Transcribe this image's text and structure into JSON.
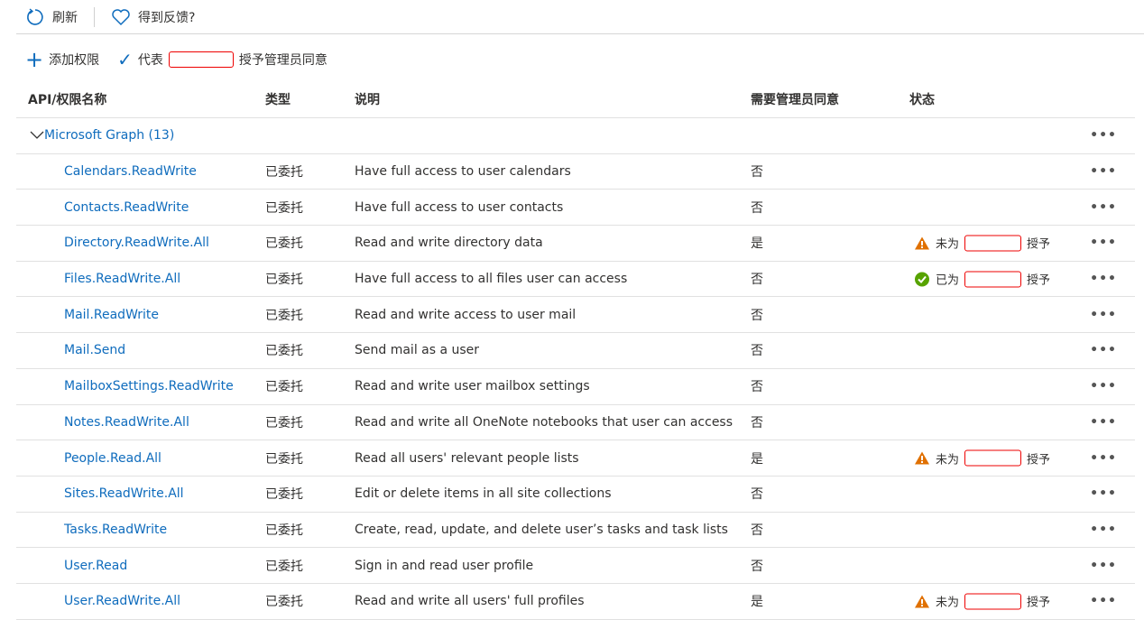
{
  "toolbar": {
    "refresh": "刷新",
    "feedback": "得到反馈?"
  },
  "commands": {
    "add": "添加权限",
    "grant_prefix": "代表",
    "grant_suffix": "授予管理员同意"
  },
  "columns": [
    "API/权限名称",
    "类型",
    "说明",
    "需要管理员同意",
    "状态"
  ],
  "group": {
    "label": "Microsoft Graph (13)"
  },
  "colors": {
    "link": "#0f6cbd",
    "warning": "#e07000",
    "success": "#57a300",
    "redact": "#e00000"
  },
  "rows": [
    {
      "name": "Calendars.ReadWrite",
      "type": "已委托",
      "desc": "Have full access to user calendars",
      "admin": "否",
      "status": "",
      "status_suffix": "",
      "status_icon": ""
    },
    {
      "name": "Contacts.ReadWrite",
      "type": "已委托",
      "desc": "Have full access to user contacts",
      "admin": "否",
      "status": "",
      "status_suffix": "",
      "status_icon": ""
    },
    {
      "name": "Directory.ReadWrite.All",
      "type": "已委托",
      "desc": "Read and write directory data",
      "admin": "是",
      "status": "未为",
      "status_suffix": "授予",
      "status_icon": "warning-icon"
    },
    {
      "name": "Files.ReadWrite.All",
      "type": "已委托",
      "desc": "Have full access to all files user can access",
      "admin": "否",
      "status": "已为",
      "status_suffix": "授予",
      "status_icon": "check-circle-icon"
    },
    {
      "name": "Mail.ReadWrite",
      "type": "已委托",
      "desc": "Read and write access to user mail",
      "admin": "否",
      "status": "",
      "status_suffix": "",
      "status_icon": ""
    },
    {
      "name": "Mail.Send",
      "type": "已委托",
      "desc": "Send mail as a user",
      "admin": "否",
      "status": "",
      "status_suffix": "",
      "status_icon": ""
    },
    {
      "name": "MailboxSettings.ReadWrite",
      "type": "已委托",
      "desc": "Read and write user mailbox settings",
      "admin": "否",
      "status": "",
      "status_suffix": "",
      "status_icon": ""
    },
    {
      "name": "Notes.ReadWrite.All",
      "type": "已委托",
      "desc": "Read and write all OneNote notebooks that user can access",
      "admin": "否",
      "status": "",
      "status_suffix": "",
      "status_icon": ""
    },
    {
      "name": "People.Read.All",
      "type": "已委托",
      "desc": "Read all users' relevant people lists",
      "admin": "是",
      "status": "未为",
      "status_suffix": "授予",
      "status_icon": "warning-icon"
    },
    {
      "name": "Sites.ReadWrite.All",
      "type": "已委托",
      "desc": "Edit or delete items in all site collections",
      "admin": "否",
      "status": "",
      "status_suffix": "",
      "status_icon": ""
    },
    {
      "name": "Tasks.ReadWrite",
      "type": "已委托",
      "desc": "Create, read, update, and delete user’s tasks and task lists",
      "admin": "否",
      "status": "",
      "status_suffix": "",
      "status_icon": ""
    },
    {
      "name": "User.Read",
      "type": "已委托",
      "desc": "Sign in and read user profile",
      "admin": "否",
      "status": "",
      "status_suffix": "",
      "status_icon": ""
    },
    {
      "name": "User.ReadWrite.All",
      "type": "已委托",
      "desc": "Read and write all users' full profiles",
      "admin": "是",
      "status": "未为",
      "status_suffix": "授予",
      "status_icon": "warning-icon"
    }
  ]
}
